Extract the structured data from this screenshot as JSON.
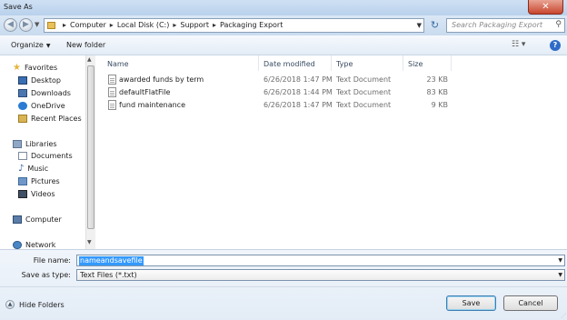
{
  "window": {
    "title": "Save As",
    "close_glyph": "✕"
  },
  "nav": {
    "back_icon": "back-arrow-icon",
    "forward_icon": "forward-arrow-icon",
    "breadcrumbs": [
      "Computer",
      "Local Disk (C:)",
      "Support",
      "Packaging Export"
    ],
    "search_placeholder": "Search Packaging Export"
  },
  "toolbar": {
    "organize_label": "Organize",
    "new_folder_label": "New folder"
  },
  "sidebar": {
    "items": [
      {
        "label": "Favorites",
        "icon": "star-icon"
      },
      {
        "label": "Desktop",
        "icon": "desktop-icon"
      },
      {
        "label": "Downloads",
        "icon": "downloads-icon"
      },
      {
        "label": "OneDrive",
        "icon": "onedrive-icon"
      },
      {
        "label": "Recent Places",
        "icon": "recent-places-icon"
      },
      {
        "label": "Libraries",
        "icon": "libraries-icon"
      },
      {
        "label": "Documents",
        "icon": "documents-icon"
      },
      {
        "label": "Music",
        "icon": "music-icon"
      },
      {
        "label": "Pictures",
        "icon": "pictures-icon"
      },
      {
        "label": "Videos",
        "icon": "videos-icon"
      },
      {
        "label": "Computer",
        "icon": "computer-icon"
      },
      {
        "label": "Network",
        "icon": "network-icon"
      }
    ]
  },
  "file_list": {
    "columns": [
      "Name",
      "Date modified",
      "Type",
      "Size"
    ],
    "rows": [
      {
        "name": "awarded funds by term",
        "date": "6/26/2018 1:47 PM",
        "type": "Text Document",
        "size": "23 KB"
      },
      {
        "name": "defaultFlatFile",
        "date": "6/26/2018 1:44 PM",
        "type": "Text Document",
        "size": "83 KB"
      },
      {
        "name": "fund maintenance",
        "date": "6/26/2018 1:47 PM",
        "type": "Text Document",
        "size": "9 KB"
      }
    ]
  },
  "form": {
    "file_name_label": "File name:",
    "file_name_value": "nameandsavefile",
    "save_type_label": "Save as type:",
    "save_type_value": "Text Files (*.txt)"
  },
  "footer": {
    "hide_folders_label": "Hide Folders",
    "save_label": "Save",
    "cancel_label": "Cancel"
  },
  "colors": {
    "accent": "#3399ff",
    "title_bar": "#c4d9f0",
    "close_button": "#c8452e"
  }
}
